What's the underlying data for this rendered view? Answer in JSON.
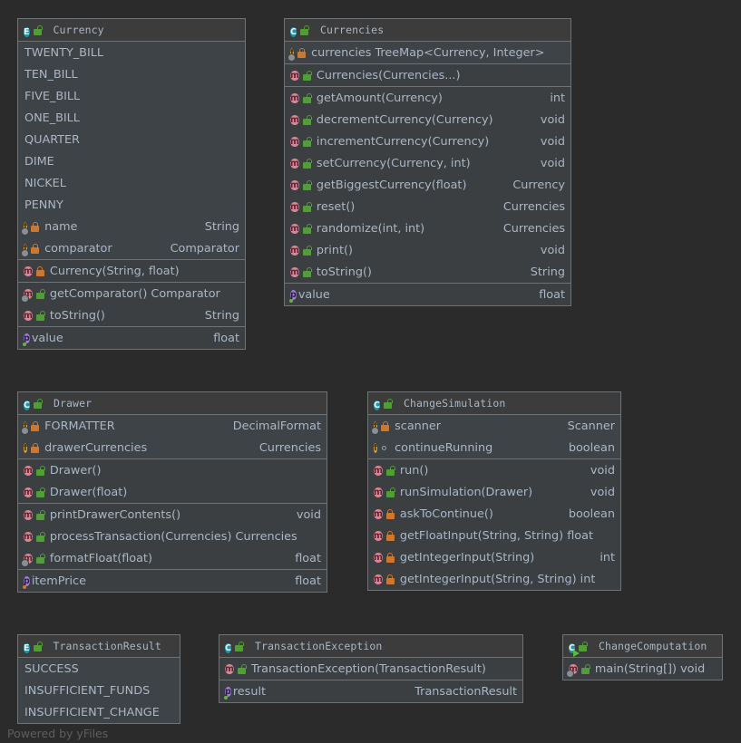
{
  "diagram": {
    "watermark": "Powered by yFiles",
    "colors": {
      "canvas": "#2b2b2b",
      "node_body": "#3c3f41",
      "node_header": "#3c3c3c",
      "border": "#6e7275",
      "text": "#a9b7c6",
      "class_icon": "#2196a8",
      "field_icon": "#d8a13a",
      "method_icon": "#d98695",
      "property_icon": "#a07fd4",
      "private_lock": "#cc7832",
      "public_lock": "#4f9e36"
    }
  },
  "nodes": [
    {
      "id": "currency",
      "kind": "enum",
      "kind_icon": "enum-icon",
      "title": "Currency",
      "title_visibility": "public",
      "sections": [
        {
          "style": "enumvals",
          "rows": [
            {
              "label": "TWENTY_BILL",
              "type": "",
              "icon": "",
              "vis": "none",
              "plain": true
            },
            {
              "label": "TEN_BILL",
              "type": "",
              "icon": "",
              "vis": "none",
              "plain": true
            },
            {
              "label": "FIVE_BILL",
              "type": "",
              "icon": "",
              "vis": "none",
              "plain": true
            },
            {
              "label": "ONE_BILL",
              "type": "",
              "icon": "",
              "vis": "none",
              "plain": true
            },
            {
              "label": "QUARTER",
              "type": "",
              "icon": "",
              "vis": "none",
              "plain": true
            },
            {
              "label": "DIME",
              "type": "",
              "icon": "",
              "vis": "none",
              "plain": true
            },
            {
              "label": "NICKEL",
              "type": "",
              "icon": "",
              "vis": "none",
              "plain": true
            },
            {
              "label": "PENNY",
              "type": "",
              "icon": "",
              "vis": "none",
              "plain": true
            },
            {
              "label": "name",
              "type": "String",
              "icon": "field-static-icon",
              "vis": "private"
            },
            {
              "label": "comparator",
              "type": "Comparator",
              "icon": "field-static-icon",
              "vis": "private"
            }
          ]
        },
        {
          "style": "members",
          "rows": [
            {
              "label": "Currency(String, float)",
              "type": "",
              "icon": "method-icon",
              "vis": "private"
            }
          ]
        },
        {
          "style": "members",
          "rows": [
            {
              "label": "getComparator() Comparator",
              "type": "",
              "icon": "method-static-icon",
              "vis": "public"
            },
            {
              "label": "toString()",
              "type": "String",
              "icon": "method-icon",
              "vis": "public"
            }
          ]
        },
        {
          "style": "members",
          "rows": [
            {
              "label": "value",
              "type": "float",
              "icon": "property-icon",
              "vis": "none"
            }
          ]
        }
      ]
    },
    {
      "id": "currencies",
      "kind": "class",
      "kind_icon": "class-icon",
      "title": "Currencies",
      "title_visibility": "public",
      "sections": [
        {
          "style": "enumvals",
          "rows": [
            {
              "label": "currencies TreeMap<Currency, Integer>",
              "type": "",
              "icon": "field-static-icon",
              "vis": "private"
            }
          ]
        },
        {
          "style": "members",
          "rows": [
            {
              "label": "Currencies(Currencies...)",
              "type": "",
              "icon": "method-icon",
              "vis": "public"
            }
          ]
        },
        {
          "style": "members",
          "rows": [
            {
              "label": "getAmount(Currency)",
              "type": "int",
              "icon": "method-icon",
              "vis": "public"
            },
            {
              "label": "decrementCurrency(Currency)",
              "type": "void",
              "icon": "method-icon",
              "vis": "public"
            },
            {
              "label": "incrementCurrency(Currency)",
              "type": "void",
              "icon": "method-icon",
              "vis": "public"
            },
            {
              "label": "setCurrency(Currency, int)",
              "type": "void",
              "icon": "method-icon",
              "vis": "public"
            },
            {
              "label": "getBiggestCurrency(float)",
              "type": "Currency",
              "icon": "method-icon",
              "vis": "public"
            },
            {
              "label": "reset()",
              "type": "Currencies",
              "icon": "method-icon",
              "vis": "public"
            },
            {
              "label": "randomize(int, int)",
              "type": "Currencies",
              "icon": "method-icon",
              "vis": "public"
            },
            {
              "label": "print()",
              "type": "void",
              "icon": "method-icon",
              "vis": "public"
            },
            {
              "label": "toString()",
              "type": "String",
              "icon": "method-icon",
              "vis": "public"
            }
          ]
        },
        {
          "style": "members",
          "rows": [
            {
              "label": "value",
              "type": "float",
              "icon": "property-icon",
              "vis": "none"
            }
          ]
        }
      ]
    },
    {
      "id": "drawer",
      "kind": "class",
      "kind_icon": "class-icon",
      "title": "Drawer",
      "title_visibility": "public",
      "sections": [
        {
          "style": "enumvals",
          "rows": [
            {
              "label": "FORMATTER",
              "type": "DecimalFormat",
              "icon": "field-static-icon",
              "vis": "private"
            },
            {
              "label": "drawerCurrencies",
              "type": "Currencies",
              "icon": "field-icon",
              "vis": "private"
            }
          ]
        },
        {
          "style": "members",
          "rows": [
            {
              "label": "Drawer()",
              "type": "",
              "icon": "method-icon",
              "vis": "public"
            },
            {
              "label": "Drawer(float)",
              "type": "",
              "icon": "method-icon",
              "vis": "public"
            }
          ]
        },
        {
          "style": "members",
          "rows": [
            {
              "label": "printDrawerContents()",
              "type": "void",
              "icon": "method-icon",
              "vis": "public"
            },
            {
              "label": "processTransaction(Currencies) Currencies",
              "type": "",
              "icon": "method-icon",
              "vis": "public"
            },
            {
              "label": "formatFloat(float)",
              "type": "float",
              "icon": "method-static-icon",
              "vis": "public"
            }
          ]
        },
        {
          "style": "members",
          "rows": [
            {
              "label": "itemPrice",
              "type": "float",
              "icon": "property-orange-icon",
              "vis": "none"
            }
          ]
        }
      ]
    },
    {
      "id": "changesimulation",
      "kind": "class",
      "kind_icon": "class-icon",
      "title": "ChangeSimulation",
      "title_visibility": "public",
      "sections": [
        {
          "style": "enumvals",
          "rows": [
            {
              "label": "scanner",
              "type": "Scanner",
              "icon": "field-static-icon",
              "vis": "private"
            },
            {
              "label": "continueRunning",
              "type": "boolean",
              "icon": "field-icon",
              "vis": "package"
            }
          ]
        },
        {
          "style": "members",
          "rows": [
            {
              "label": "run()",
              "type": "void",
              "icon": "method-icon",
              "vis": "public"
            },
            {
              "label": "runSimulation(Drawer)",
              "type": "void",
              "icon": "method-icon",
              "vis": "public"
            },
            {
              "label": "askToContinue()",
              "type": "boolean",
              "icon": "method-icon",
              "vis": "private"
            },
            {
              "label": "getFloatInput(String, String) float",
              "type": "",
              "icon": "method-icon",
              "vis": "private"
            },
            {
              "label": "getIntegerInput(String)",
              "type": "int",
              "icon": "method-icon",
              "vis": "private"
            },
            {
              "label": "getIntegerInput(String, String) int",
              "type": "",
              "icon": "method-icon",
              "vis": "private"
            }
          ]
        }
      ]
    },
    {
      "id": "transactionresult",
      "kind": "enum",
      "kind_icon": "enum-icon",
      "title": "TransactionResult",
      "title_visibility": "public",
      "sections": [
        {
          "style": "enumvals",
          "rows": [
            {
              "label": "SUCCESS",
              "type": "",
              "icon": "",
              "vis": "none",
              "plain": true
            },
            {
              "label": "INSUFFICIENT_FUNDS",
              "type": "",
              "icon": "",
              "vis": "none",
              "plain": true
            },
            {
              "label": "INSUFFICIENT_CHANGE",
              "type": "",
              "icon": "",
              "vis": "none",
              "plain": true
            }
          ]
        }
      ]
    },
    {
      "id": "transactionexception",
      "kind": "class",
      "kind_icon": "class-icon",
      "title": "TransactionException",
      "title_visibility": "public",
      "sections": [
        {
          "style": "members",
          "rows": [
            {
              "label": "TransactionException(TransactionResult)",
              "type": "",
              "icon": "method-icon",
              "vis": "public"
            }
          ]
        },
        {
          "style": "members",
          "rows": [
            {
              "label": "result",
              "type": "TransactionResult",
              "icon": "property-icon",
              "vis": "none"
            }
          ]
        }
      ]
    },
    {
      "id": "changecomputation",
      "kind": "class-runnable",
      "kind_icon": "class-runnable-icon",
      "title": "ChangeComputation",
      "title_visibility": "public",
      "sections": [
        {
          "style": "members",
          "rows": [
            {
              "label": "main(String[]) void",
              "type": "",
              "icon": "method-static-icon",
              "vis": "public"
            }
          ]
        }
      ]
    }
  ]
}
